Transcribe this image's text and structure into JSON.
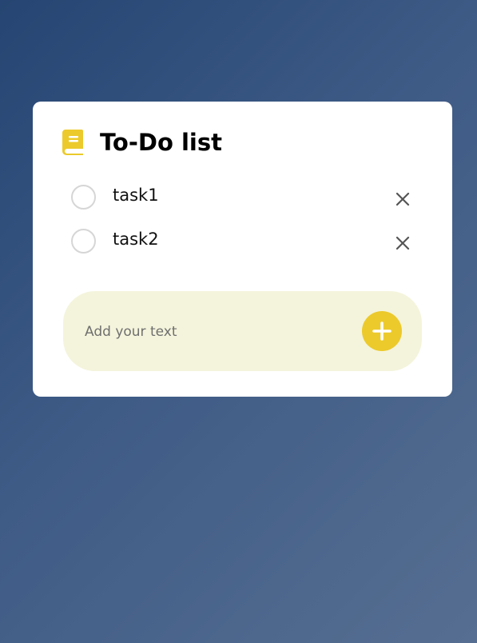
{
  "app": {
    "title": "To-Do list",
    "title_icon": "book-icon",
    "accent_color": "#ecca2b"
  },
  "tasks": [
    {
      "text": "task1",
      "done": false,
      "delete_icon": "close-icon"
    },
    {
      "text": "task2",
      "done": false,
      "delete_icon": "close-icon"
    }
  ],
  "input": {
    "placeholder": "Add your text",
    "value": ""
  },
  "add_button": {
    "icon": "plus-icon"
  }
}
